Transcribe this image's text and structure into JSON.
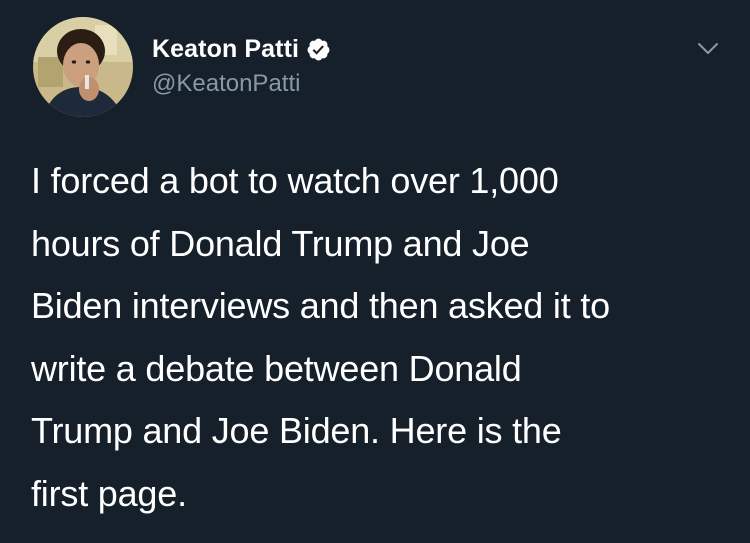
{
  "author": {
    "display_name": "Keaton Patti",
    "handle": "@KeatonPatti",
    "verified": true,
    "avatar_icon": "user-avatar-photo"
  },
  "tweet": {
    "text": "I forced a bot to watch over 1,000\nhours of Donald Trump and Joe\nBiden interviews and then asked it to\nwrite a debate between Donald\nTrump and Joe Biden. Here is the\nfirst page."
  },
  "icons": {
    "verified": "verified-badge-icon",
    "menu": "chevron-down-icon"
  },
  "colors": {
    "background": "#15202b",
    "text_primary": "#ffffff",
    "text_secondary": "#8899a6",
    "chevron": "#8899a6"
  }
}
